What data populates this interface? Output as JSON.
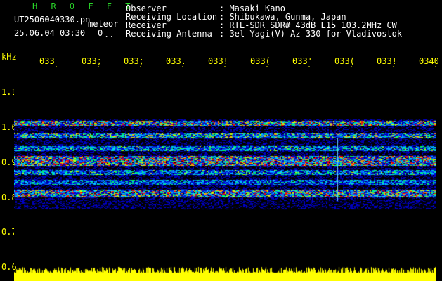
{
  "header": {
    "title": "H R O F F T",
    "filename": "UT2506040330.pn",
    "mode": "meteor",
    "datetime": "25.06.04 03:30",
    "count": "0",
    "count_suffix": "..",
    "labels": [
      "Observer",
      "Receiving Location",
      "Receiver",
      "Receiving Antenna"
    ],
    "values": [
      ": Masaki Kano",
      ": Shibukawa, Gunma, Japan",
      ": RTL-SDR SDR# 43dB L15 103.2MHz CW",
      ": 3el Yagi(V) Az 330 for Vladivostok"
    ]
  },
  "axis": {
    "y_unit": "kHz",
    "y_ticks": [
      "1.1",
      "1.0",
      "0.9",
      "0.8",
      "0.7",
      "0.6"
    ],
    "x_ticks": [
      "033",
      "033;",
      "033;",
      "033.",
      "033!",
      "033(",
      "033'",
      "033(",
      "033!",
      "0340"
    ]
  },
  "colors": {
    "background": "#000000",
    "header_text": "#ffffff",
    "title_green": "#29d629",
    "axis_yellow": "#ffff00",
    "spectrum_low": "#000080",
    "spectrum_high": "#ff0000"
  }
}
